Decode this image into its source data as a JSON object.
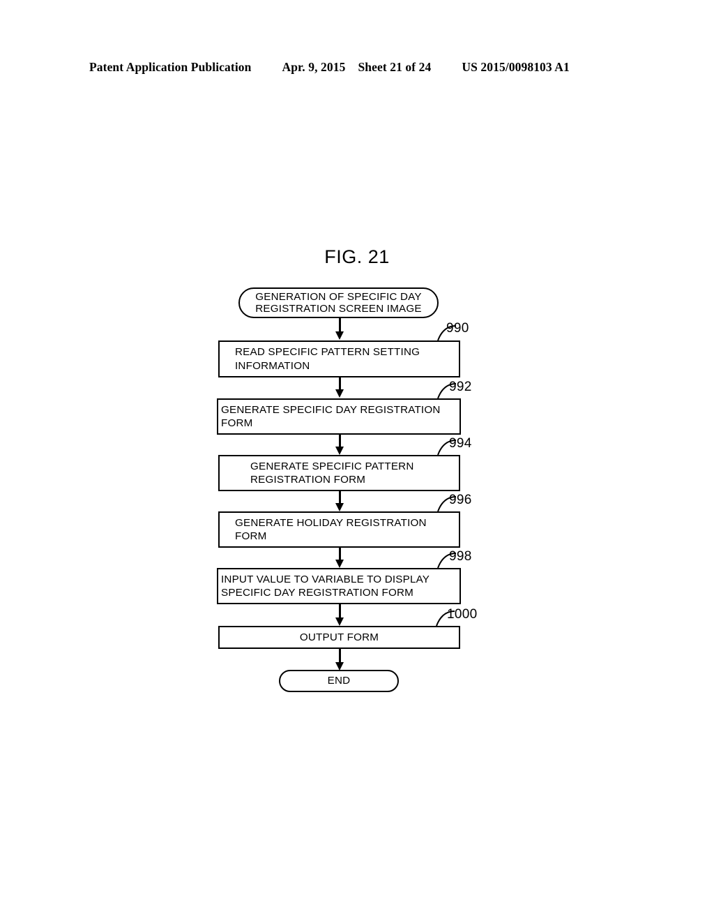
{
  "header": {
    "publication": "Patent Application Publication",
    "date": "Apr. 9, 2015",
    "sheet": "Sheet 21 of 24",
    "number": "US 2015/0098103 A1"
  },
  "figure": {
    "title": "FIG. 21",
    "type": "flowchart",
    "ink_color": "#000000",
    "background_color": "#ffffff"
  },
  "flowchart": {
    "start": {
      "shape": "terminal",
      "line1": "GENERATION OF SPECIFIC DAY",
      "line2": "REGISTRATION SCREEN IMAGE"
    },
    "steps": [
      {
        "ref": "990",
        "shape": "process",
        "align": "left",
        "line1": "READ SPECIFIC PATTERN SETTING",
        "line2": "INFORMATION"
      },
      {
        "ref": "992",
        "shape": "process",
        "align": "left",
        "line1": "GENERATE SPECIFIC DAY REGISTRATION",
        "line2": "FORM"
      },
      {
        "ref": "994",
        "shape": "process",
        "align": "left",
        "line1": "GENERATE SPECIFIC PATTERN",
        "line2": "REGISTRATION FORM"
      },
      {
        "ref": "996",
        "shape": "process",
        "align": "left",
        "line1": "GENERATE HOLIDAY REGISTRATION",
        "line2": "FORM"
      },
      {
        "ref": "998",
        "shape": "process",
        "align": "left",
        "line1": "INPUT VALUE TO VARIABLE TO DISPLAY",
        "line2": "SPECIFIC DAY REGISTRATION FORM"
      },
      {
        "ref": "1000",
        "shape": "process",
        "align": "center",
        "line1": "OUTPUT FORM",
        "line2": ""
      }
    ],
    "end": {
      "shape": "terminal",
      "label": "END"
    }
  }
}
